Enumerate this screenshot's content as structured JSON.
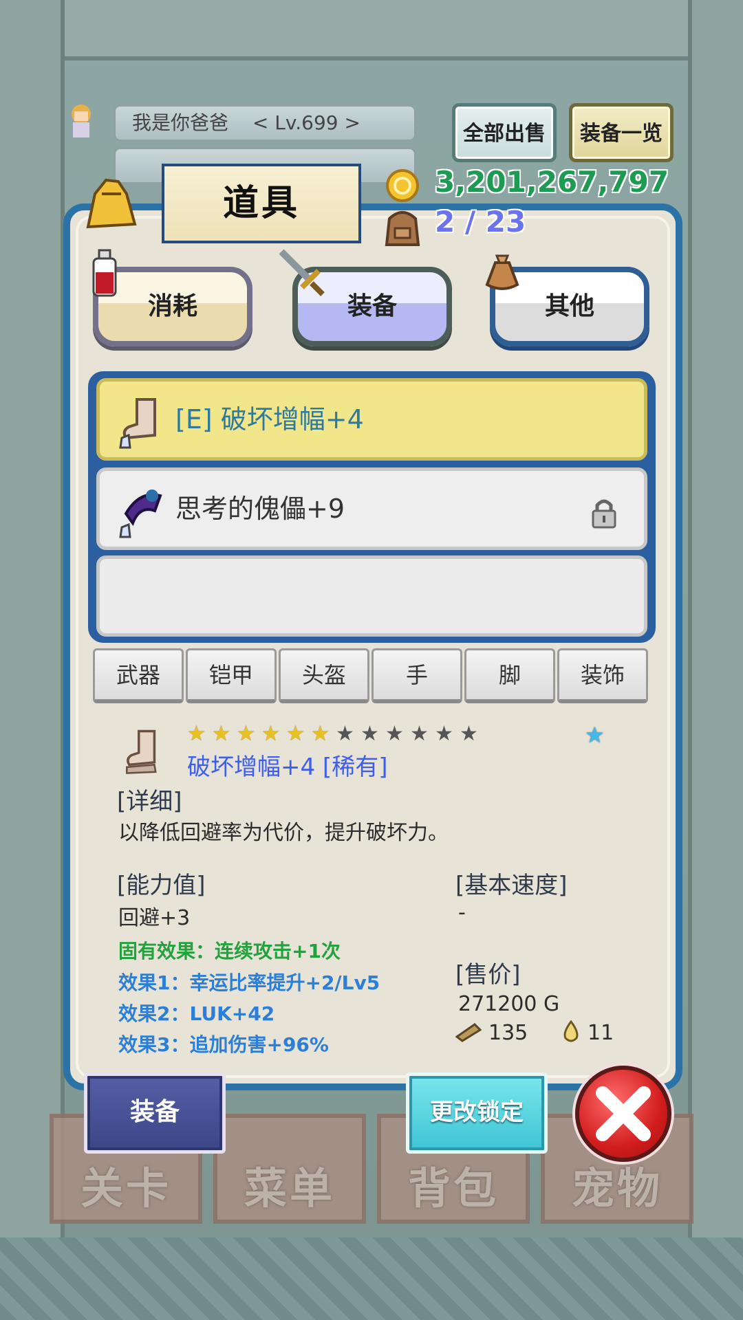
{
  "player": {
    "name": "我是你爸爸",
    "level": "< Lv.699 >",
    "gold_small": "3,201,267,797"
  },
  "header_buttons": {
    "sell_all": "全部出售",
    "equip_list": "装备一览"
  },
  "panel": {
    "title": "道具",
    "gold": "3,201,267,797",
    "capacity": "2 / 23"
  },
  "category_tabs": [
    {
      "label": "消耗"
    },
    {
      "label": "装备"
    },
    {
      "label": "其他"
    }
  ],
  "items": [
    {
      "name": "[E] 破坏增幅+4",
      "selected": true,
      "locked": false
    },
    {
      "name": "思考的傀儡+9",
      "selected": false,
      "locked": true
    },
    {
      "name": "",
      "selected": false,
      "locked": false
    }
  ],
  "filter_tabs": [
    "武器",
    "铠甲",
    "头盔",
    "手",
    "脚",
    "装饰"
  ],
  "detail": {
    "stars_filled": 6,
    "stars_total": 12,
    "title": "破坏增幅+4 [稀有]",
    "detail_header": "[详细]",
    "description": "以降低回避率为代价，提升破坏力。",
    "stats_header": "[能力值]",
    "stat_evasion": "回避+3",
    "inherent": "固有效果：连续攻击+1次",
    "effect1": "效果1：幸运比率提升+2/Lv5",
    "effect2": "效果2：LUK+42",
    "effect3": "效果3：追加伤害+96%",
    "speed_header": "[基本速度]",
    "speed_value": "-",
    "price_header": "[售价]",
    "price_value": "271200 G",
    "material1": "135",
    "material2": "11"
  },
  "buttons": {
    "equip": "装备",
    "toggle_lock": "更改锁定"
  },
  "bottom_nav": [
    "关卡",
    "菜单",
    "背包",
    "宠物"
  ],
  "colors": {
    "panel_border": "#2b73a7",
    "gold_text": "#1e9b52",
    "capacity_text": "#6b73ef",
    "selected_item": "#f2e68a",
    "rare_title": "#3d5ef0"
  }
}
